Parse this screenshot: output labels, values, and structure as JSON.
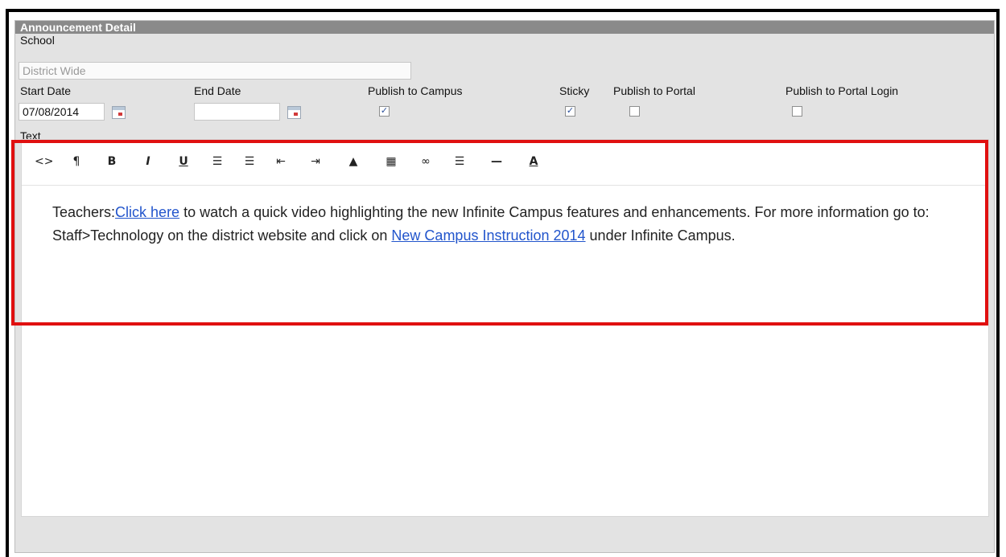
{
  "panel": {
    "title": "Announcement Detail"
  },
  "school": {
    "label": "School",
    "value": "District Wide"
  },
  "start_date": {
    "label": "Start Date",
    "value": "07/08/2014"
  },
  "end_date": {
    "label": "End Date",
    "value": ""
  },
  "publish_campus": {
    "label": "Publish to Campus",
    "checked": true
  },
  "sticky": {
    "label": "Sticky",
    "checked": true
  },
  "publish_portal": {
    "label": "Publish to Portal",
    "checked": false
  },
  "publish_portal_login": {
    "label": "Publish to Portal Login",
    "checked": false
  },
  "text_label": "Text",
  "toolbar": {
    "html": "<>",
    "paragraph": "¶",
    "bold": "B",
    "italic": "I",
    "underline": "U",
    "unordered_list": "☰",
    "ordered_list": "☰",
    "outdent": "⇤",
    "indent": "⇥",
    "image": "▲",
    "table": "▦",
    "link": "∞",
    "align": "☰",
    "hr": "—",
    "font_color": "A"
  },
  "content": {
    "lead": "Teachers:",
    "link1": "Click here",
    "mid": " to watch a quick video highlighting the new Infinite Campus features and enhancements. For more information go to: Staff>Technology on the district website and click on ",
    "link2": "New Campus Instruction 2014",
    "tail": " under Infinite Campus."
  },
  "colors": {
    "highlight": "#e01010",
    "link": "#2255cc",
    "header": "#8a8a8a"
  }
}
